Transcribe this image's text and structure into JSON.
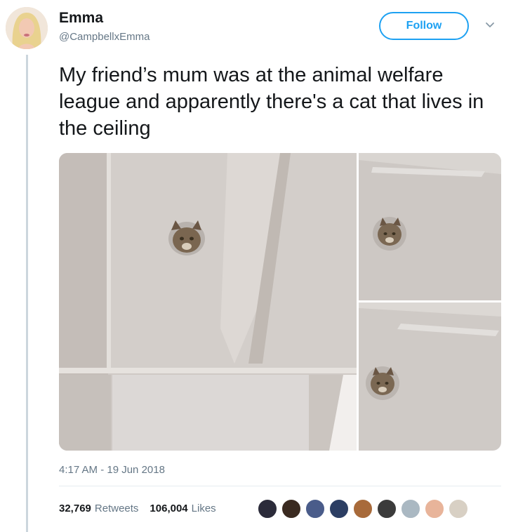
{
  "user": {
    "name": "Emma",
    "handle": "@CampbellxEmma"
  },
  "follow_label": "Follow",
  "tweet": {
    "text": "My friend’s mum was at the animal welfare league and apparently there's a cat that lives in the ceiling",
    "timestamp": "4:17 AM - 19 Jun 2018"
  },
  "stats": {
    "retweets_count": "32,769",
    "retweets_label": "Retweets",
    "likes_count": "106,004",
    "likes_label": "Likes"
  },
  "likers": [
    {
      "color": "#2b2b3a"
    },
    {
      "color": "#3a2a20"
    },
    {
      "color": "#4a5c8a"
    },
    {
      "color": "#2c3e63"
    },
    {
      "color": "#a86a3a"
    },
    {
      "color": "#3b3b3b"
    },
    {
      "color": "#aab8c2"
    },
    {
      "color": "#e8b49a"
    },
    {
      "color": "#d8d0c4"
    }
  ],
  "colors": {
    "accent": "#1da1f2",
    "secondary_text": "#657786",
    "thread_line": "#ccd6dd"
  }
}
